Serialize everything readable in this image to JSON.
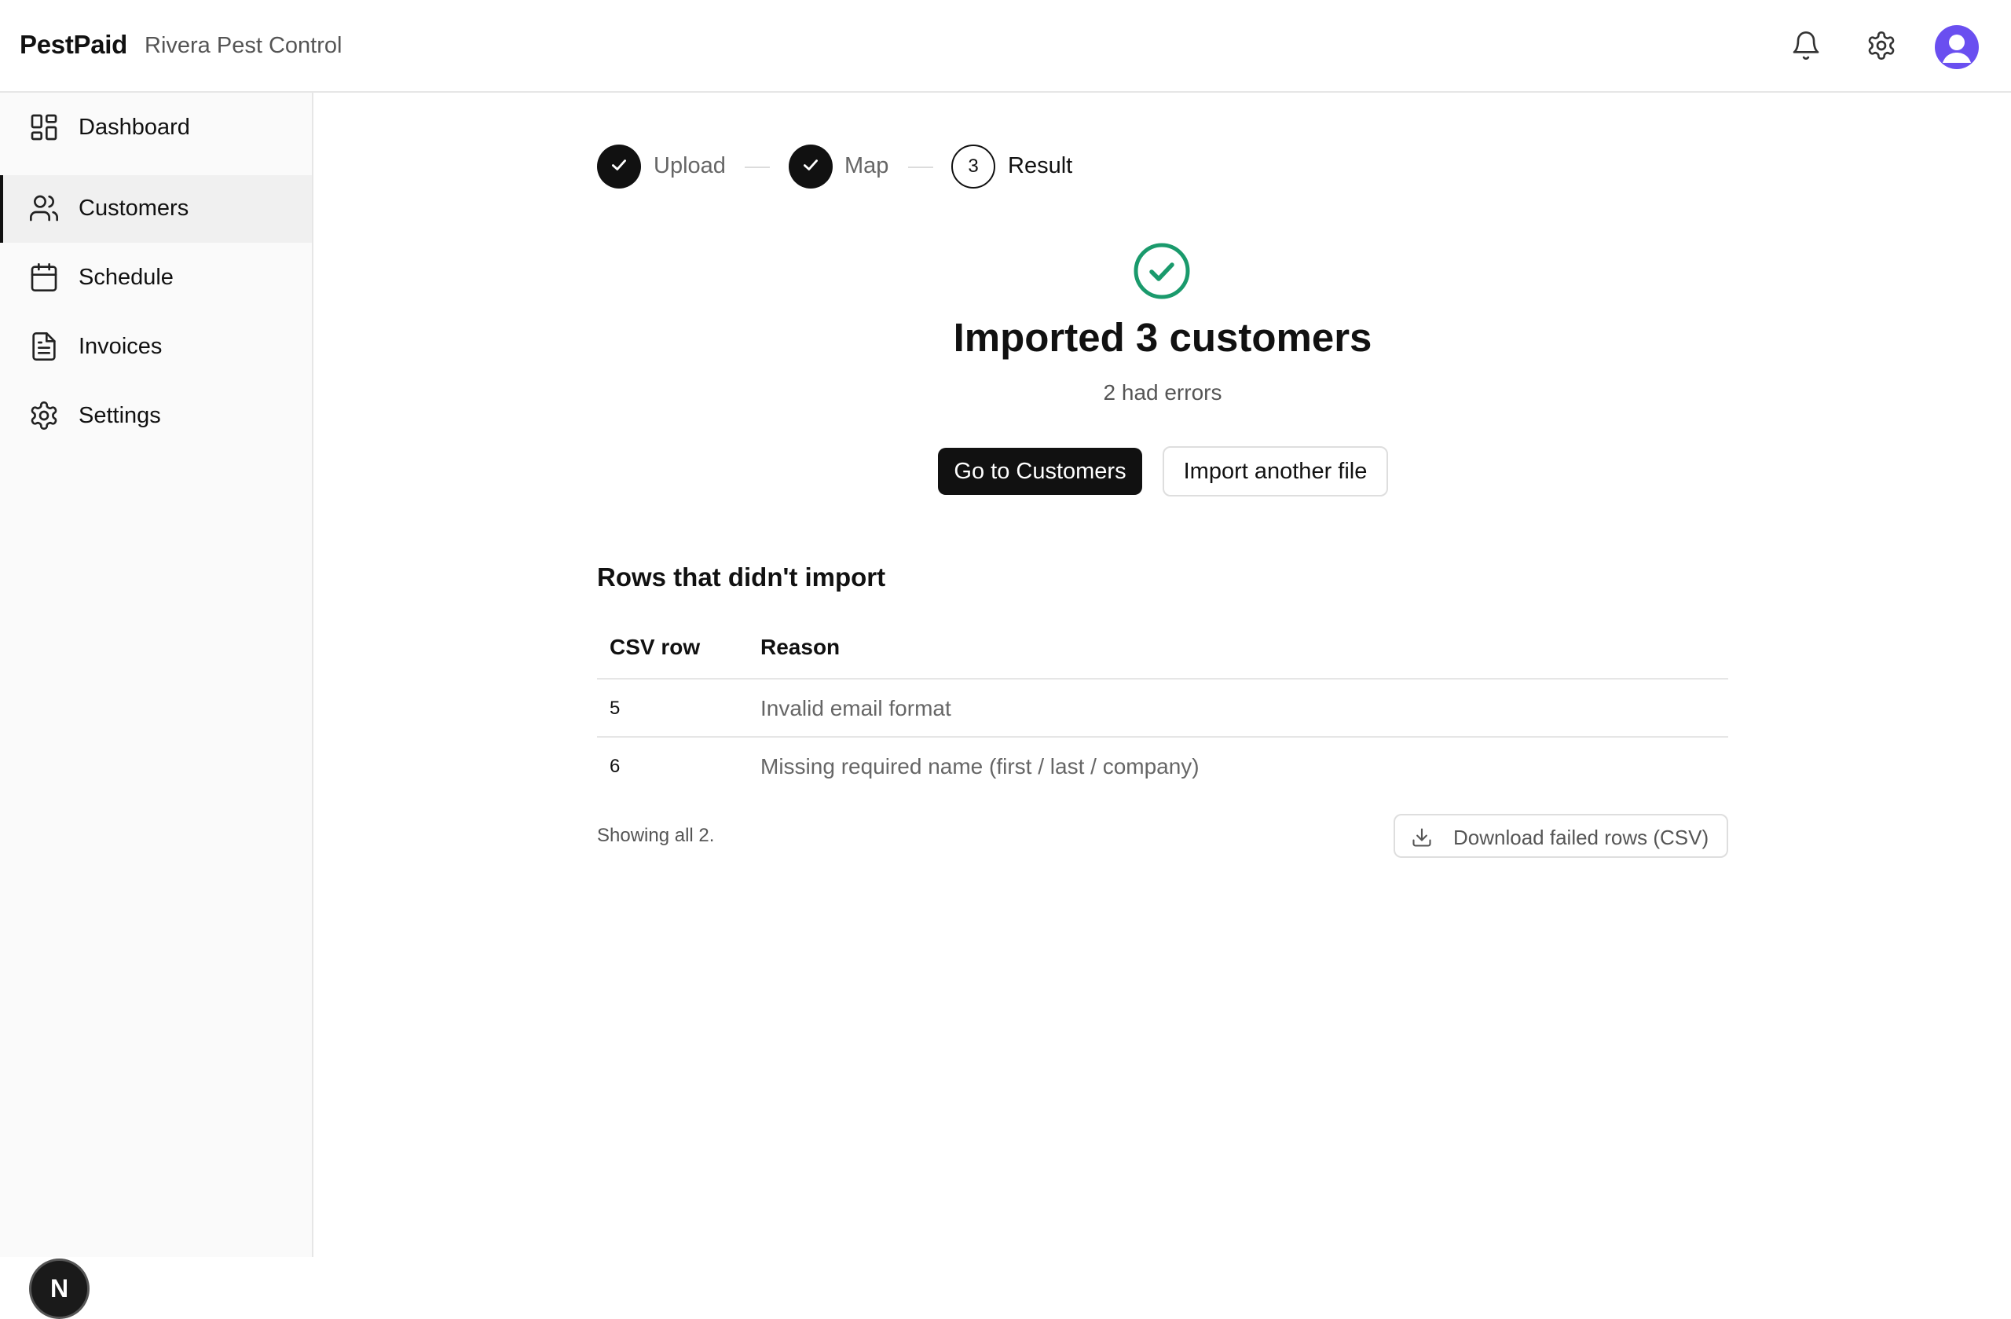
{
  "header": {
    "brand": "PestPaid",
    "organization": "Rivera Pest Control",
    "icons": [
      "bell-icon",
      "gear-icon",
      "user-avatar-icon"
    ]
  },
  "sidebar": {
    "items": [
      {
        "label": "Dashboard",
        "icon": "dashboard-grid-icon",
        "active": false
      },
      {
        "label": "Customers",
        "icon": "users-icon",
        "active": true
      },
      {
        "label": "Schedule",
        "icon": "calendar-icon",
        "active": false
      },
      {
        "label": "Invoices",
        "icon": "document-icon",
        "active": false
      },
      {
        "label": "Settings",
        "icon": "gear-icon",
        "active": false
      }
    ],
    "footer_badge": "N"
  },
  "stepper": {
    "steps": [
      {
        "label": "Upload",
        "state": "done"
      },
      {
        "label": "Map",
        "state": "done"
      },
      {
        "label": "Result",
        "state": "current",
        "number": "3"
      }
    ]
  },
  "result": {
    "title": "Imported 3 customers",
    "subtitle": "2 had errors",
    "primary_button": "Go to Customers",
    "secondary_button": "Import another file"
  },
  "failed_rows": {
    "title": "Rows that didn't import",
    "columns": [
      "CSV row",
      "Reason"
    ],
    "rows": [
      {
        "row": "5",
        "reason": "Invalid email format"
      },
      {
        "row": "6",
        "reason": "Missing required name (first / last / company)"
      }
    ],
    "showing": "Showing all 2.",
    "download_button": "Download failed rows (CSV)"
  },
  "colors": {
    "accent": "#111111",
    "success": "#1a9a6c",
    "avatar": "#6a4ff0",
    "sidebar_bg": "#fafafa"
  }
}
